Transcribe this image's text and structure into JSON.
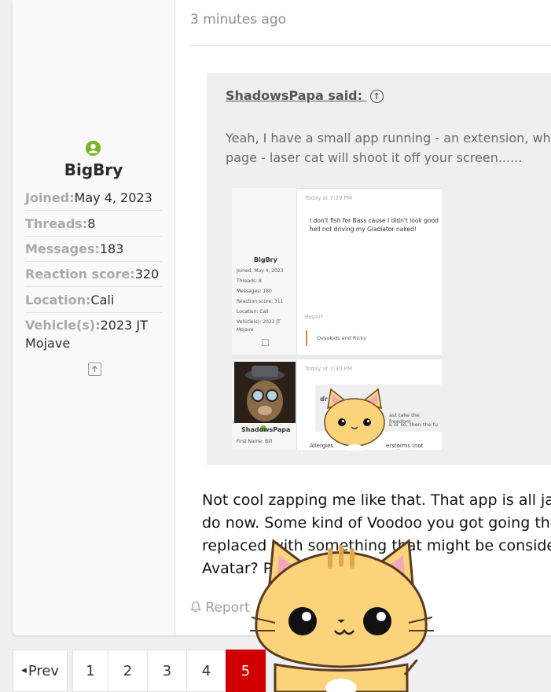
{
  "post": {
    "timestamp": "3 minutes ago",
    "report_label": "Report",
    "body_lines": [
      "Not cool zapping me like that. That app is all jack",
      "do now. Some kind of Voodoo you got going the",
      "replaced with something that might be considere",
      "Avatar? Pl"
    ]
  },
  "user": {
    "name": "BigBry",
    "stats": [
      {
        "key": "Joined:",
        "value": "May 4, 2023"
      },
      {
        "key": "Threads:",
        "value": "8"
      },
      {
        "key": "Messages:",
        "value": "183"
      },
      {
        "key": "Reaction score:",
        "value": "320"
      },
      {
        "key": "Location:",
        "value": "Cali"
      },
      {
        "key": "Vehicle(s):",
        "value": "2023 JT Mojave"
      }
    ]
  },
  "quote": {
    "author_label": "ShadowsPapa said:",
    "lines": [
      "Yeah, I have a small app running - an extension, wher",
      "page - laser cat will shoot it off your screen......"
    ],
    "embed": {
      "time1": "Today at 7:29 PM",
      "msg1": "I don't fish for Bass cause I didn't look good i",
      "msg2": "hell not driving my Gladiator naked!",
      "user": "BigBry",
      "joined": "Joined: May 4, 2023",
      "threads": "Threads: 8",
      "messages": "Messages: 180",
      "reaction": "Reaction score: 311",
      "location": "Location: Cali",
      "vehicle": "Vehicle(s): 2023 JT",
      "vehicle2": "Mojave",
      "report": "Report",
      "reactions": "Ovsukids and Ricky",
      "time2": "Today at 7:30 PM",
      "user2": "ShadowsPapa",
      "firstname": "First Name: Bill",
      "allergies": "Allergies",
      "storms": "erstorms (not predic",
      "take": "ast take the freedom",
      "orso": "k or so, then the fu",
      "dr": "dr"
    }
  },
  "pagination": {
    "prev_label": "Prev",
    "pages": [
      "1",
      "2",
      "3",
      "4",
      "5"
    ],
    "current": "5"
  },
  "colors": {
    "accent_red": "#d00000",
    "online_green": "#7cb32a"
  },
  "icons": [
    "user-circle-icon",
    "share-icon",
    "arrow-up-circle-icon",
    "bell-icon",
    "caret-left-icon"
  ]
}
